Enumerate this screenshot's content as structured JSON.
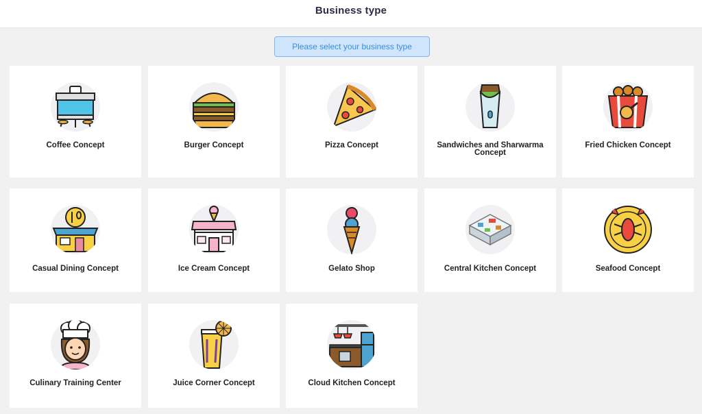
{
  "header": {
    "title": "Business type"
  },
  "prompt": {
    "text": "Please select your business type"
  },
  "cards": [
    {
      "label": "Coffee Concept",
      "icon": "coffee-shop-icon"
    },
    {
      "label": "Burger Concept",
      "icon": "burger-icon"
    },
    {
      "label": "Pizza Concept",
      "icon": "pizza-slice-icon"
    },
    {
      "label": "Sandwiches and Sharwarma Concept",
      "icon": "wrap-icon"
    },
    {
      "label": "Fried Chicken Concept",
      "icon": "fried-chicken-bucket-icon"
    },
    {
      "label": "Casual Dining Concept",
      "icon": "restaurant-icon"
    },
    {
      "label": "Ice Cream Concept",
      "icon": "ice-cream-shop-icon"
    },
    {
      "label": "Gelato Shop",
      "icon": "gelato-cone-icon"
    },
    {
      "label": "Central Kitchen Concept",
      "icon": "kitchen-floorplan-icon"
    },
    {
      "label": "Seafood Concept",
      "icon": "lobster-icon"
    },
    {
      "label": "Culinary Training Center",
      "icon": "chef-icon"
    },
    {
      "label": "Juice Corner Concept",
      "icon": "juice-glass-icon"
    },
    {
      "label": "Cloud Kitchen Concept",
      "icon": "cloud-kitchen-icon"
    }
  ]
}
